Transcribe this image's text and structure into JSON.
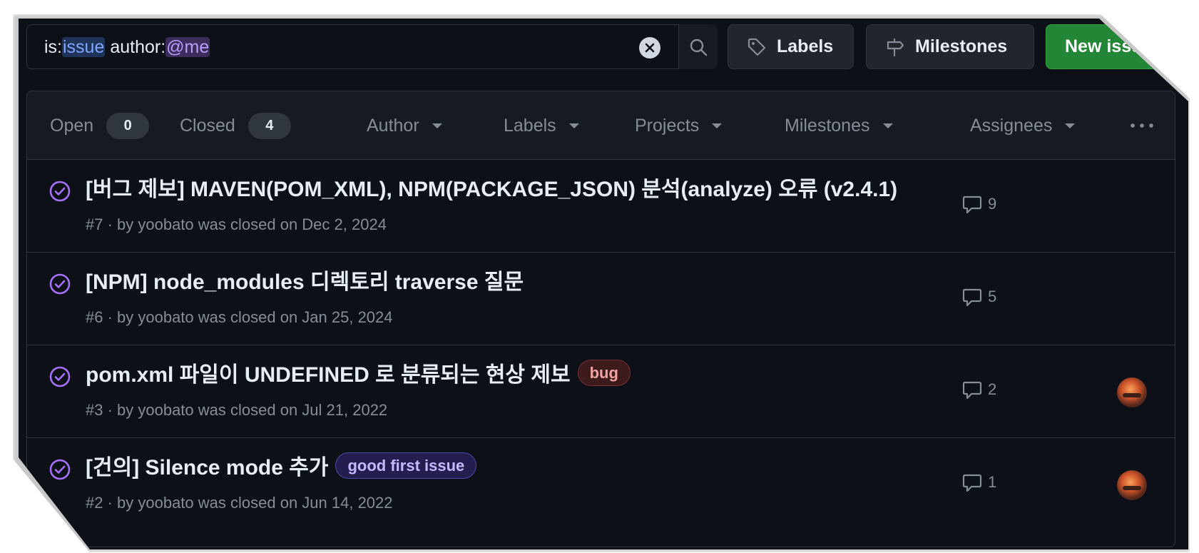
{
  "search": {
    "key1": "is:",
    "val1": "issue",
    "key2": " author:",
    "val2": "@me"
  },
  "toolbar": {
    "labels_label": "Labels",
    "milestones_label": "Milestones",
    "new_issue_label": "New issue"
  },
  "states": {
    "open_label": "Open",
    "open_count": "0",
    "closed_label": "Closed",
    "closed_count": "4"
  },
  "filters": {
    "author": "Author",
    "labels": "Labels",
    "projects": "Projects",
    "milestones": "Milestones",
    "assignees": "Assignees"
  },
  "issues": [
    {
      "title": "[버그 제보] MAVEN(POM_XML), NPM(PACKAGE_JSON) 분석(analyze) 오류 (v2.4.1)",
      "meta": "#7 · by yoobato was closed on Dec 2, 2024",
      "comments": "9"
    },
    {
      "title": "[NPM] node_modules 디렉토리 traverse 질문",
      "meta": "#6 · by yoobato was closed on Jan 25, 2024",
      "comments": "5"
    },
    {
      "title": "pom.xml 파일이 UNDEFINED 로 분류되는 현상 제보",
      "label": "bug",
      "meta": "#3 · by yoobato was closed on Jul 21, 2022",
      "comments": "2"
    },
    {
      "title": "[건의] Silence mode 추가",
      "label": "good first issue",
      "meta": "#2 · by yoobato was closed on Jun 14, 2022",
      "comments": "1"
    }
  ],
  "colors": {
    "background": "#0d1117",
    "header": "#161b22",
    "border": "#30363d",
    "closed_icon": "#a371f7",
    "new_button": "#238636"
  },
  "icons": [
    "clear-icon",
    "search-icon",
    "tag-icon",
    "milestone-icon",
    "caret-down-icon",
    "kebab-horizontal-icon",
    "issue-closed-icon",
    "comment-icon",
    "avatar"
  ]
}
